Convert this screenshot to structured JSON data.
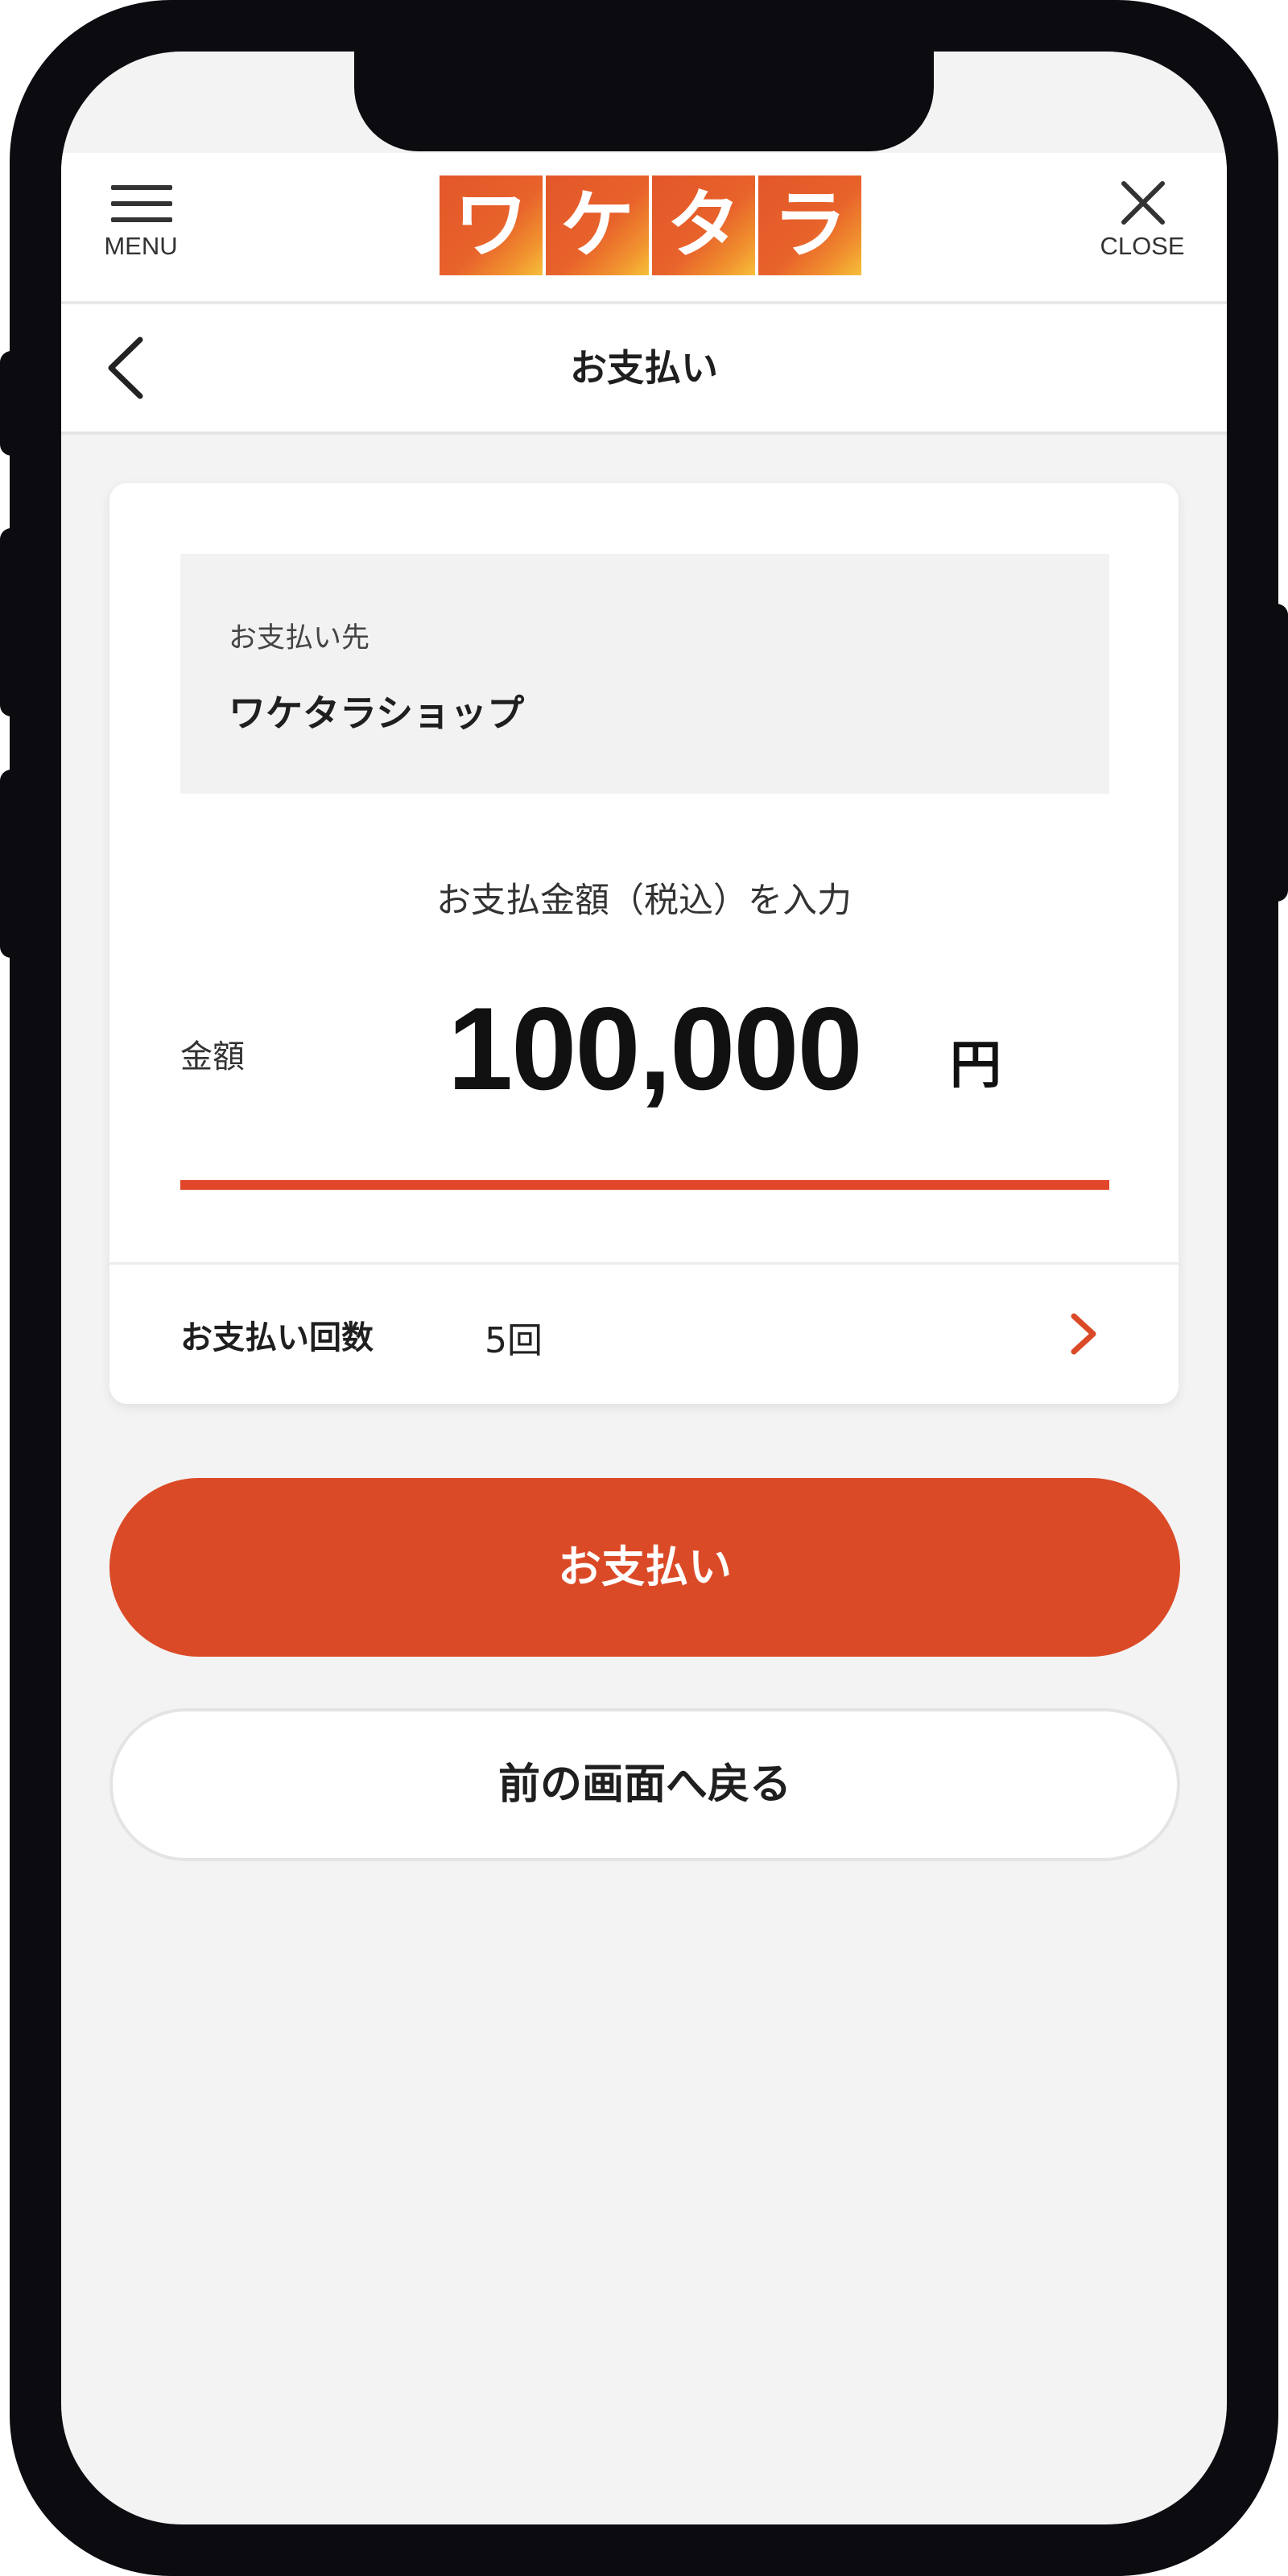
{
  "header": {
    "menu_label": "MENU",
    "close_label": "CLOSE",
    "logo_chars": [
      "ワ",
      "ケ",
      "タ",
      "ラ"
    ]
  },
  "title_bar": {
    "title": "お支払い"
  },
  "payment": {
    "payee_label": "お支払い先",
    "payee_name": "ワケタラショップ",
    "amount_prompt": "お支払金額（税込）を入力",
    "amount_label": "金額",
    "amount_value": "100,000",
    "amount_unit": "円",
    "installments_label": "お支払い回数",
    "installments_value": "5回"
  },
  "buttons": {
    "pay_label": "お支払い",
    "back_label": "前の画面へ戻る"
  },
  "icons": {
    "menu": "hamburger-icon",
    "close": "close-icon",
    "back": "chevron-left-icon",
    "installments": "chevron-right-icon"
  },
  "colors": {
    "accent": "#db4a27",
    "underline": "#e1462a",
    "logo_gradient_start": "#e2572a",
    "logo_gradient_end": "#f6c03a",
    "background": "#f3f3f3",
    "frame": "#0b0b10"
  }
}
